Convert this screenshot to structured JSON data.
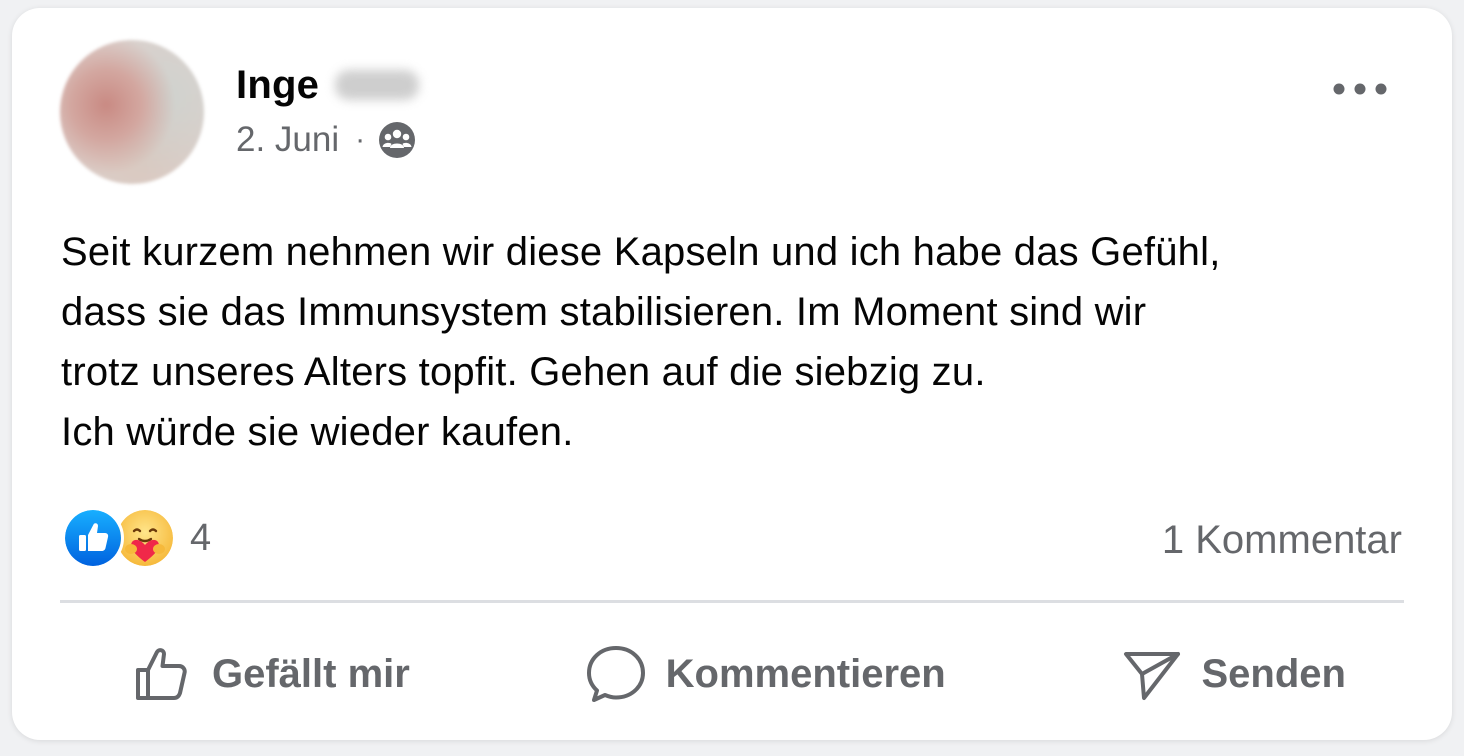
{
  "post": {
    "author_first_name": "Inge",
    "date": "2. Juni",
    "separator": "·",
    "audience_icon": "friends-icon",
    "more_icon": "more-options-icon",
    "text": "Seit kurzem nehmen wir diese Kapseln und ich habe das Gefühl,\ndass sie das Immunsystem stabilisieren. Im Moment sind wir\ntrotz unseres Alters topfit. Gehen auf die siebzig zu.\nIch würde sie wieder kaufen."
  },
  "reactions": {
    "types": [
      "like-reaction-icon",
      "care-reaction-icon"
    ],
    "count": "4",
    "comments": "1 Kommentar"
  },
  "actions": {
    "like_label": "Gefällt mir",
    "comment_label": "Kommentieren",
    "send_label": "Senden"
  },
  "colors": {
    "like_blue": "#0866ff",
    "secondary_text": "#65676b",
    "primary_text": "#050505",
    "divider": "#dcdee2"
  }
}
